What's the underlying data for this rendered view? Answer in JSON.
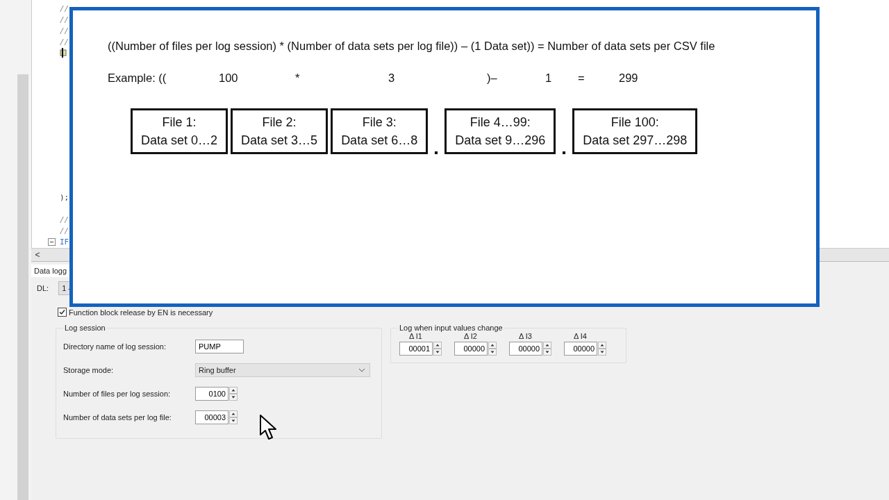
{
  "editor": {
    "lines": [
      {
        "kind": "comment",
        "text": "//"
      },
      {
        "kind": "comment",
        "text": "//"
      },
      {
        "kind": "comment",
        "text": "//"
      },
      {
        "kind": "comment",
        "text": "//"
      },
      {
        "kind": "marker"
      },
      {
        "kind": "blank"
      },
      {
        "kind": "blank"
      },
      {
        "kind": "blank"
      },
      {
        "kind": "blank"
      },
      {
        "kind": "blank"
      },
      {
        "kind": "blank"
      },
      {
        "kind": "blank"
      },
      {
        "kind": "blank"
      },
      {
        "kind": "blank"
      },
      {
        "kind": "blank"
      },
      {
        "kind": "blank"
      },
      {
        "kind": "blank"
      },
      {
        "kind": "code",
        "text": ");"
      },
      {
        "kind": "blank"
      },
      {
        "kind": "comment",
        "text": "//"
      },
      {
        "kind": "comment",
        "text": "//"
      },
      {
        "kind": "keyword",
        "text": "IF"
      }
    ],
    "scroll_left": "<"
  },
  "overlay": {
    "formula": "((Number of files per log session) * (Number of data sets per log file)) – (1 Data set)) = Number of data sets per CSV file",
    "example": [
      "Example: ((",
      "100",
      "*",
      "3",
      ")–",
      "1",
      "=",
      "299"
    ],
    "files": [
      {
        "title": "File 1:",
        "range": "Data set 0…2"
      },
      {
        "title": "File 2:",
        "range": "Data set 3…5"
      },
      {
        "title": "File 3:",
        "range": "Data set 6…8"
      },
      {
        "title": "File 4…99:",
        "range": "Data set 9…296"
      },
      {
        "title": "File 100:",
        "range": "Data set 297…298"
      }
    ]
  },
  "panel": {
    "tab": "Data logg",
    "dl_label": "DL:",
    "dl_value": "1 -",
    "release_checkbox": {
      "label": "Function block release by EN is necessary",
      "checked": true
    },
    "log_session": {
      "title": "Log session",
      "directory": {
        "label": "Directory name of log session:",
        "value": "PUMP"
      },
      "storage_mode": {
        "label": "Storage mode:",
        "value": "Ring buffer"
      },
      "files_per_session": {
        "label": "Number of files per log session:",
        "value": "0100"
      },
      "data_sets_per_file": {
        "label": "Number of data sets per log file:",
        "value": "00003"
      }
    },
    "input_change": {
      "title": "Log when input values change",
      "inputs": [
        {
          "label": "Δ I1",
          "value": "00001"
        },
        {
          "label": "Δ I2",
          "value": "00000"
        },
        {
          "label": "Δ I3",
          "value": "00000"
        },
        {
          "label": "Δ I4",
          "value": "00000"
        }
      ]
    }
  }
}
